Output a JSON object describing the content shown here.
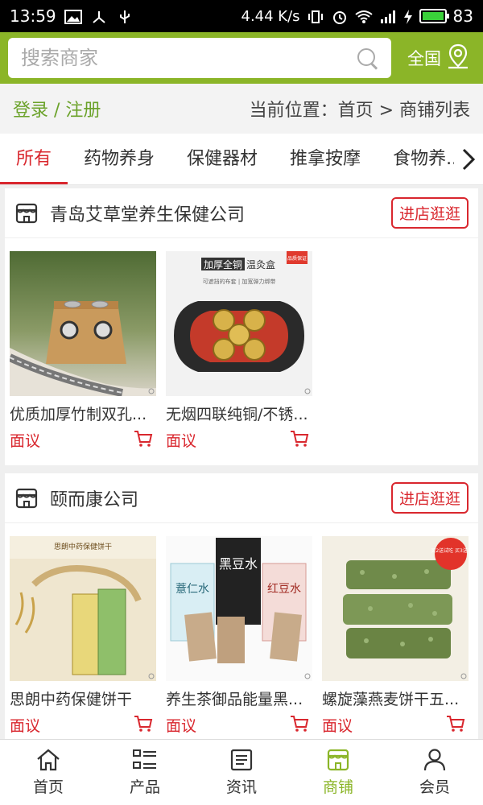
{
  "status": {
    "time": "13:59",
    "speed": "4.44 K/s",
    "battery": "83"
  },
  "search": {
    "placeholder": "搜索商家",
    "region": "全国"
  },
  "location": {
    "login": "登录 / 注册",
    "breadcrumb": "当前位置：首页 > 商铺列表"
  },
  "tabs": [
    {
      "label": "所有",
      "active": true
    },
    {
      "label": "药物养身"
    },
    {
      "label": "保健器材"
    },
    {
      "label": "推拿按摩"
    },
    {
      "label": "食物养..."
    }
  ],
  "shops": [
    {
      "name": "青岛艾草堂养生保健公司",
      "enter": "进店逛逛",
      "products": [
        {
          "name": "优质加厚竹制双孔...",
          "price": "面议"
        },
        {
          "name": "无烟四联纯铜/不锈...",
          "price": "面议",
          "banner": "加厚全铜",
          "banner_suffix": "温灸盒",
          "sub": "可遮挡的布套 | 加宽弹力绑带",
          "badge": "品质保证"
        }
      ]
    },
    {
      "name": "颐而康公司",
      "enter": "进店逛逛",
      "products": [
        {
          "name": "思朗中药保健饼干",
          "price": "面议",
          "box_label": "思朗中药保健饼干"
        },
        {
          "name": "养生茶御品能量黑...",
          "price": "面议",
          "tea1": "黑豆水",
          "tea2": "薏仁水",
          "tea3": "红豆水"
        },
        {
          "name": "螺旋藻燕麦饼干五...",
          "price": "面议",
          "badge": "买2送试吃 买3送1"
        }
      ]
    }
  ],
  "nav": [
    {
      "label": "首页",
      "icon": "home-icon"
    },
    {
      "label": "产品",
      "icon": "list-icon"
    },
    {
      "label": "资讯",
      "icon": "news-icon"
    },
    {
      "label": "商铺",
      "icon": "shop-icon",
      "active": true
    },
    {
      "label": "会员",
      "icon": "user-icon"
    }
  ],
  "colors": {
    "brand": "#8bb528",
    "accent": "#d9272e",
    "link": "#6ba22a"
  }
}
